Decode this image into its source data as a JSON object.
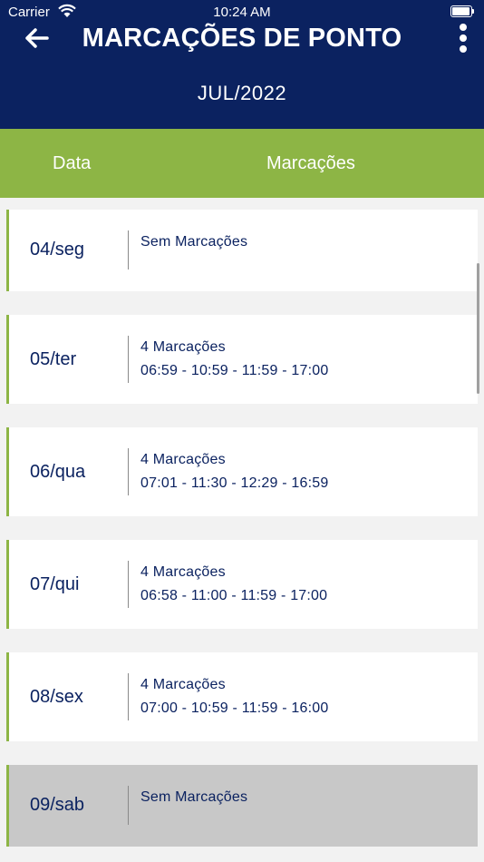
{
  "status_bar": {
    "carrier": "Carrier",
    "time": "10:24 AM",
    "wifi_icon": "wifi-icon",
    "battery_icon": "battery-icon"
  },
  "header": {
    "title": "MARCAÇÕES DE PONTO",
    "month": "JUL/2022",
    "back_icon": "arrow-left-icon",
    "menu_icon": "more-vertical-icon"
  },
  "columns": {
    "date": "Data",
    "marks": "Marcações"
  },
  "colors": {
    "header_bg": "#0b2260",
    "accent_green": "#8db545",
    "text_navy": "#0b2260",
    "weekend_bg": "#c8c8c8"
  },
  "days": [
    {
      "date": "04/seg",
      "count": "Sem Marcações",
      "times": ""
    },
    {
      "date": "05/ter",
      "count": "4 Marcações",
      "times": "06:59 - 10:59 - 11:59 - 17:00"
    },
    {
      "date": "06/qua",
      "count": "4 Marcações",
      "times": "07:01 - 11:30 - 12:29 - 16:59"
    },
    {
      "date": "07/qui",
      "count": "4 Marcações",
      "times": "06:58 - 11:00 - 11:59 - 17:00"
    },
    {
      "date": "08/sex",
      "count": "4 Marcações",
      "times": "07:00 - 10:59 - 11:59 - 16:00"
    },
    {
      "date": "09/sab",
      "count": "Sem Marcações",
      "times": ""
    }
  ]
}
